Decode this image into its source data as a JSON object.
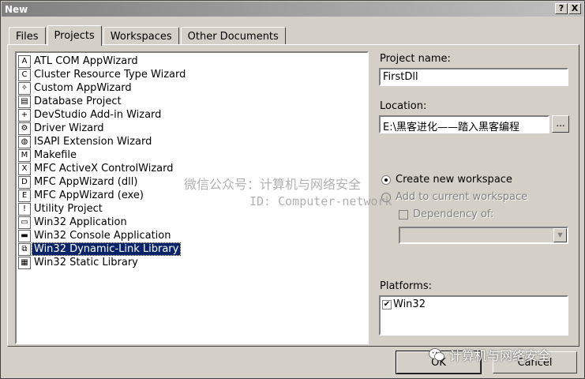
{
  "window": {
    "title": "New",
    "help_btn": "?",
    "close_btn": "X"
  },
  "tabs": [
    {
      "label": "Files"
    },
    {
      "label": "Projects",
      "active": true
    },
    {
      "label": "Workspaces"
    },
    {
      "label": "Other Documents"
    }
  ],
  "project_types": [
    {
      "label": "ATL COM AppWizard",
      "icon": "atl-icon"
    },
    {
      "label": "Cluster Resource Type Wizard",
      "icon": "cluster-icon"
    },
    {
      "label": "Custom AppWizard",
      "icon": "wizard-icon"
    },
    {
      "label": "Database Project",
      "icon": "database-icon"
    },
    {
      "label": "DevStudio Add-in Wizard",
      "icon": "addin-icon"
    },
    {
      "label": "Driver Wizard",
      "icon": "driver-icon"
    },
    {
      "label": "ISAPI Extension Wizard",
      "icon": "globe-icon"
    },
    {
      "label": "Makefile",
      "icon": "makefile-icon"
    },
    {
      "label": "MFC ActiveX ControlWizard",
      "icon": "activex-icon"
    },
    {
      "label": "MFC AppWizard (dll)",
      "icon": "mfc-dll-icon"
    },
    {
      "label": "MFC AppWizard (exe)",
      "icon": "mfc-exe-icon"
    },
    {
      "label": "Utility Project",
      "icon": "utility-icon"
    },
    {
      "label": "Win32 Application",
      "icon": "window-icon"
    },
    {
      "label": "Win32 Console Application",
      "icon": "console-icon"
    },
    {
      "label": "Win32 Dynamic-Link Library",
      "icon": "dll-icon",
      "selected": true
    },
    {
      "label": "Win32 Static Library",
      "icon": "library-icon"
    }
  ],
  "project_name": {
    "label": "Project name:",
    "value": "FirstDll"
  },
  "location": {
    "label": "Location:",
    "value": "E:\\黑客进化——踏入黑客编程",
    "browse_label": "..."
  },
  "workspace": {
    "create_label": "Create new workspace",
    "add_label": "Add to current workspace",
    "dependency_label": "Dependency of:"
  },
  "platforms": {
    "label": "Platforms:",
    "items": [
      {
        "label": "Win32",
        "checked": true
      }
    ]
  },
  "buttons": {
    "ok": "OK",
    "cancel": "Cancel"
  },
  "watermark": {
    "line1": "微信公众号：计算机与网络安全",
    "line2": "ID: Computer-network",
    "brand": "计算机与网络安全"
  }
}
